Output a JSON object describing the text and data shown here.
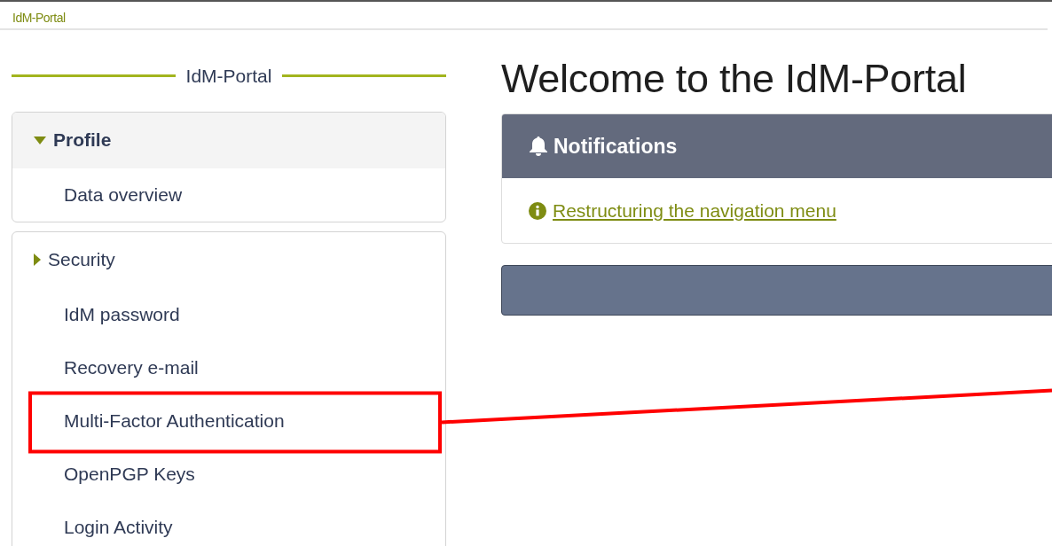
{
  "top_bar": {
    "title": "IdM-Portal"
  },
  "sidebar": {
    "heading": "IdM-Portal",
    "sections": [
      {
        "label": "Profile",
        "expanded": true,
        "items": [
          {
            "label": "Data overview",
            "highlighted": false
          }
        ]
      },
      {
        "label": "Security",
        "expanded": false,
        "items": [
          {
            "label": "IdM password",
            "highlighted": false
          },
          {
            "label": "Recovery e-mail",
            "highlighted": false
          },
          {
            "label": "Multi-Factor Authentication",
            "highlighted": true
          },
          {
            "label": "OpenPGP Keys",
            "highlighted": false
          },
          {
            "label": "Login Activity",
            "highlighted": false
          }
        ]
      }
    ]
  },
  "main": {
    "title": "Welcome to the IdM-Portal",
    "notifications": {
      "title": "Notifications",
      "items": [
        {
          "text": "Restructuring the navigation menu"
        }
      ]
    }
  }
}
